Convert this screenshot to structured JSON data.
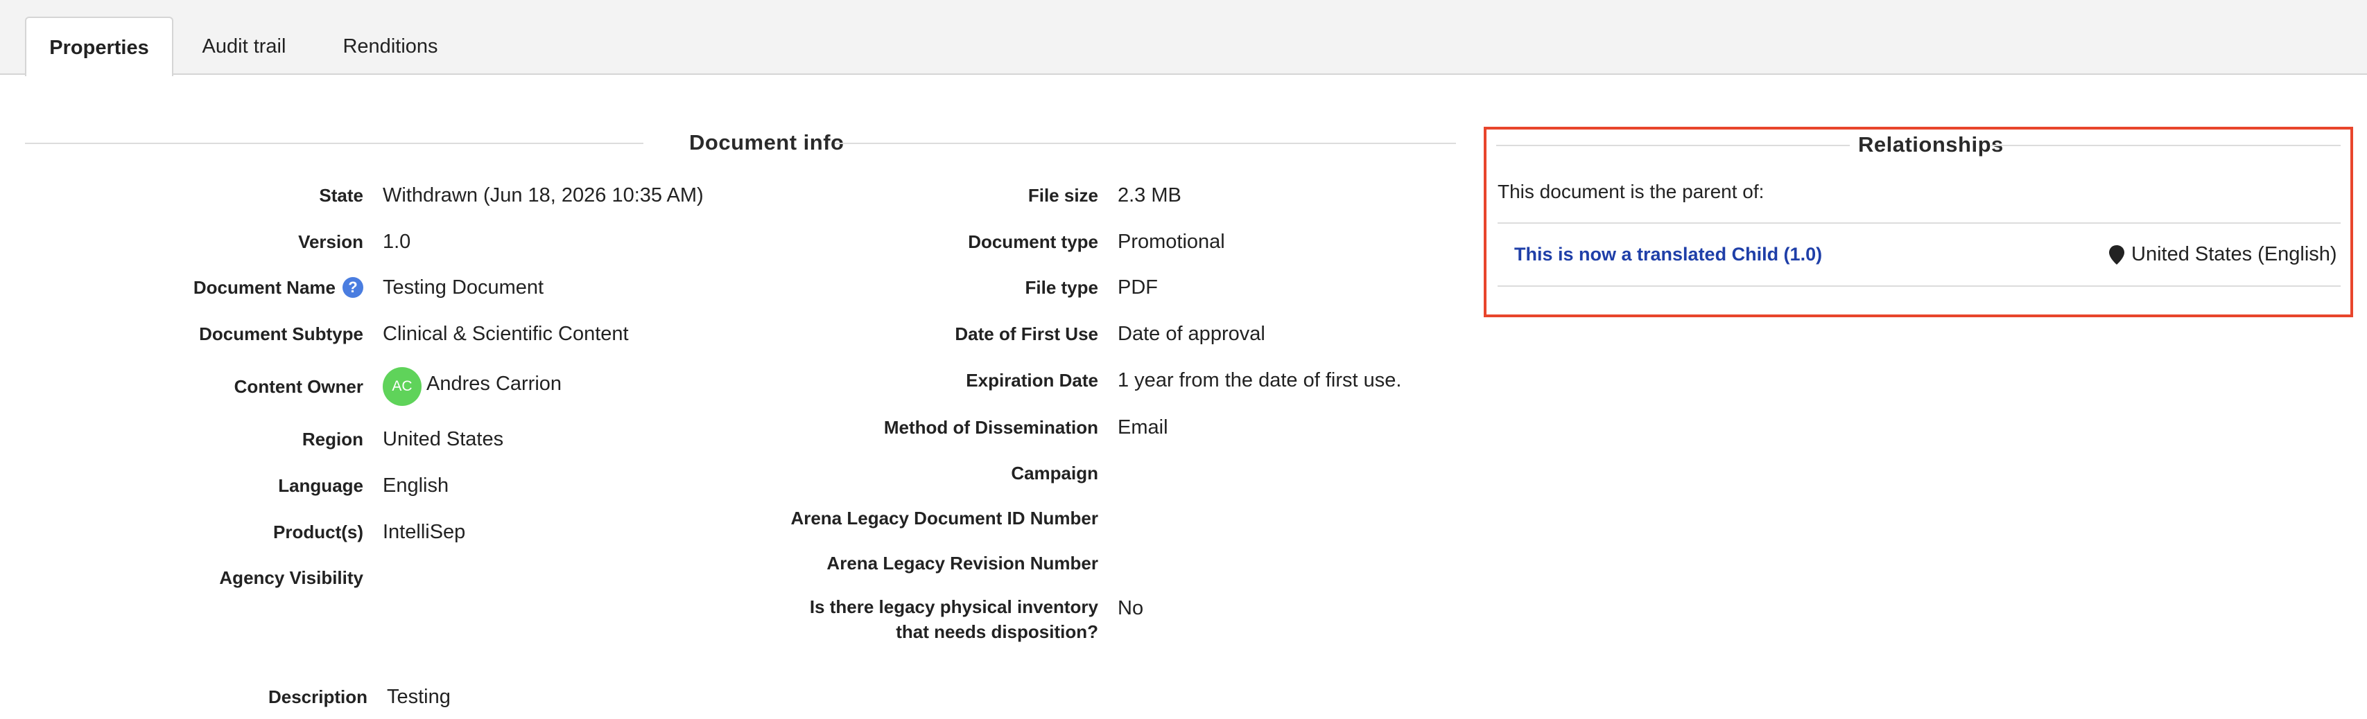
{
  "tabs": [
    {
      "label": "Properties",
      "active": true
    },
    {
      "label": "Audit trail",
      "active": false
    },
    {
      "label": "Renditions",
      "active": false
    }
  ],
  "document_info": {
    "heading": "Document info",
    "left": [
      {
        "label": "State",
        "value": "Withdrawn (Jun 18, 2026 10:35 AM)"
      },
      {
        "label": "Version",
        "value": "1.0"
      },
      {
        "label": "Document Name",
        "value": "Testing Document"
      },
      {
        "label": "Document Subtype",
        "value": "Clinical & Scientific Content"
      },
      {
        "label": "Content Owner",
        "value": "Andres Carrion",
        "avatar_initials": "AC"
      },
      {
        "label": "Region",
        "value": "United States"
      },
      {
        "label": "Language",
        "value": "English"
      },
      {
        "label": "Product(s)",
        "value": "IntelliSep"
      },
      {
        "label": "Agency Visibility",
        "value": ""
      }
    ],
    "right": [
      {
        "label": "File size",
        "value": "2.3 MB"
      },
      {
        "label": "Document type",
        "value": "Promotional"
      },
      {
        "label": "File type",
        "value": "PDF"
      },
      {
        "label": "Date of First Use",
        "value": "Date of approval"
      },
      {
        "label": "Expiration Date",
        "value": "1 year from the date of first use."
      },
      {
        "label": "Method of Dissemination",
        "value": "Email"
      },
      {
        "label": "Campaign",
        "value": ""
      },
      {
        "label": "Arena Legacy Document ID Number",
        "value": ""
      },
      {
        "label": "Arena Legacy Revision Number",
        "value": ""
      },
      {
        "label": "Is there legacy physical inventory that needs disposition?",
        "value": "No"
      }
    ],
    "description": {
      "label": "Description",
      "value": "Testing"
    }
  },
  "relationships": {
    "heading": "Relationships",
    "intro": "This document is the parent of:",
    "items": [
      {
        "title": "This is now a translated Child (1.0)",
        "locale": "United States (English)"
      }
    ]
  },
  "colors": {
    "link": "#1f3fa8",
    "highlight_border": "#e8452c",
    "avatar": "#5fd35a",
    "help_icon": "#4a7de0"
  }
}
